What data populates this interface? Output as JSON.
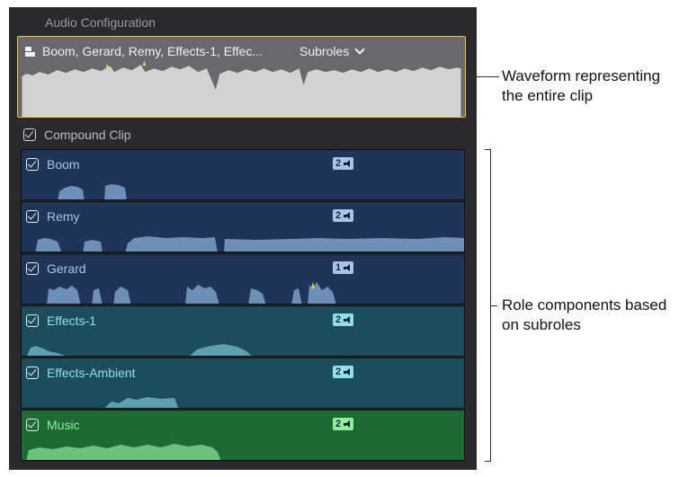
{
  "panel": {
    "title": "Audio Configuration"
  },
  "top_clip": {
    "name": "Boom, Gerard, Remy, Effects-1, Effec...",
    "subroles_label": "Subroles"
  },
  "compound": {
    "label": "Compound Clip",
    "checked": true
  },
  "lanes": [
    {
      "label": "Boom",
      "channels": "2",
      "checked": true,
      "color": "#1f3457",
      "wave": "#6f8fb8",
      "badge": "#a9c4ea"
    },
    {
      "label": "Remy",
      "channels": "2",
      "checked": true,
      "color": "#1f3457",
      "wave": "#6f8fb8",
      "badge": "#a9c4ea"
    },
    {
      "label": "Gerard",
      "channels": "1",
      "checked": true,
      "color": "#1f3457",
      "wave": "#6f8fb8",
      "badge": "#a9c4ea"
    },
    {
      "label": "Effects-1",
      "channels": "2",
      "checked": true,
      "color": "#1d4d5b",
      "wave": "#5fa0b0",
      "badge": "#8fe0ec"
    },
    {
      "label": "Effects-Ambient",
      "channels": "2",
      "checked": true,
      "color": "#1d4d5b",
      "wave": "#5fa0b0",
      "badge": "#8fe0ec"
    },
    {
      "label": "Music",
      "channels": "2",
      "checked": true,
      "color": "#1f6a34",
      "wave": "#6ec07e",
      "badge": "#8ef09c"
    }
  ],
  "annotations": {
    "waveform_line1": "Waveform representing",
    "waveform_line2": "the entire clip",
    "roles_line1": "Role components based",
    "roles_line2": "on subroles"
  },
  "icons": {
    "clip": "compound-clip-icon",
    "chevron": "chevron-down-icon",
    "checkbox": "checkbox-checked-icon",
    "speaker": "speaker-icon"
  }
}
